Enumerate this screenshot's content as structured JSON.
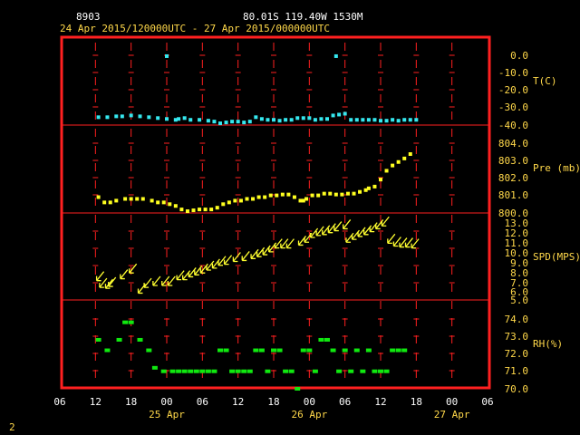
{
  "header": {
    "station_id": "8903",
    "location": "80.01S  119.40W  1530M",
    "time_range": "24 Apr 2015/120000UTC - 27 Apr 2015/000000UTC"
  },
  "footer": {
    "page_marker": "2"
  },
  "colors": {
    "background": "#000000",
    "frame": "#ff2020",
    "text_white": "#ffffff",
    "text_yellow": "#ffd84a",
    "temperature": "#35e8ef",
    "pressure": "#ffff20",
    "wind": "#ffff30",
    "rh": "#10e810"
  },
  "x_axis": {
    "hours": [
      "06",
      "12",
      "18",
      "00",
      "06",
      "12",
      "18",
      "00",
      "06",
      "12",
      "18",
      "00",
      "06"
    ],
    "dates": [
      "25 Apr",
      "26 Apr",
      "27 Apr"
    ]
  },
  "panels": {
    "temperature": {
      "label": "T(C)",
      "ticks": [
        "0.0",
        "-10.0",
        "-20.0",
        "-30.0",
        "-40.0"
      ]
    },
    "pressure": {
      "label": "Pre (mb)",
      "ticks": [
        "804.0",
        "803.0",
        "802.0",
        "801.0",
        "800.0"
      ]
    },
    "wind": {
      "label": "SPD(MPS)",
      "ticks": [
        "13.0",
        "12.0",
        "11.0",
        "10.0",
        "9.0",
        "8.0",
        "7.0",
        "6.0",
        "5.0"
      ]
    },
    "rh": {
      "label": "RH(%)",
      "ticks": [
        "74.0",
        "73.0",
        "72.0",
        "71.0",
        "70.0"
      ]
    }
  },
  "chart_data": {
    "type": "scatter",
    "title": "8903  80.01S 119.40W 1530M",
    "subtitle": "24 Apr 2015/120000UTC - 27 Apr 2015/000000UTC",
    "x_unit": "hours since 24 Apr 2015 06 UTC",
    "x_range": [
      0,
      72
    ],
    "series": [
      {
        "name": "T(C)",
        "ylim": [
          -40,
          0
        ],
        "points": [
          [
            6.5,
            -35.5
          ],
          [
            8,
            -35.5
          ],
          [
            9.5,
            -35
          ],
          [
            10.5,
            -35
          ],
          [
            12,
            -34.5
          ],
          [
            13.5,
            -35
          ],
          [
            15,
            -35.5
          ],
          [
            16.5,
            -36
          ],
          [
            18,
            -0.5
          ],
          [
            18,
            -36.5
          ],
          [
            19.5,
            -37
          ],
          [
            20,
            -36.5
          ],
          [
            21,
            -36
          ],
          [
            22,
            -37
          ],
          [
            23.5,
            -37
          ],
          [
            25,
            -37.5
          ],
          [
            26,
            -38
          ],
          [
            27,
            -39
          ],
          [
            28,
            -38.5
          ],
          [
            29,
            -38
          ],
          [
            30,
            -38
          ],
          [
            31,
            -38.5
          ],
          [
            32,
            -38
          ],
          [
            33,
            -35.5
          ],
          [
            34,
            -36.5
          ],
          [
            35,
            -37
          ],
          [
            36,
            -37
          ],
          [
            37,
            -37.5
          ],
          [
            38,
            -37
          ],
          [
            39,
            -37
          ],
          [
            40,
            -36
          ],
          [
            41,
            -36
          ],
          [
            42,
            -36
          ],
          [
            43,
            -37
          ],
          [
            44,
            -36.5
          ],
          [
            45,
            -36.5
          ],
          [
            46,
            -34.5
          ],
          [
            46.5,
            -0.5
          ],
          [
            47,
            -34
          ],
          [
            48,
            -33.5
          ],
          [
            49,
            -37
          ],
          [
            50,
            -37
          ],
          [
            51,
            -37
          ],
          [
            52,
            -37
          ],
          [
            53,
            -37
          ],
          [
            54,
            -37.5
          ],
          [
            55,
            -37.5
          ],
          [
            56,
            -37
          ],
          [
            57,
            -37.5
          ],
          [
            58,
            -37
          ],
          [
            59,
            -37
          ],
          [
            60,
            -37
          ]
        ]
      },
      {
        "name": "Pre (mb)",
        "ylim": [
          800,
          805
        ],
        "points": [
          [
            6.5,
            800.9
          ],
          [
            7.5,
            800.6
          ],
          [
            8.5,
            800.6
          ],
          [
            9.5,
            800.7
          ],
          [
            11,
            800.8
          ],
          [
            12,
            800.8
          ],
          [
            13,
            800.8
          ],
          [
            14,
            800.8
          ],
          [
            15.5,
            800.7
          ],
          [
            16.5,
            800.6
          ],
          [
            17.5,
            800.6
          ],
          [
            18.5,
            800.5
          ],
          [
            19.5,
            800.4
          ],
          [
            20.5,
            800.2
          ],
          [
            21.5,
            800.1
          ],
          [
            22.5,
            800.15
          ],
          [
            23.5,
            800.2
          ],
          [
            24.5,
            800.2
          ],
          [
            25.5,
            800.2
          ],
          [
            26.5,
            800.3
          ],
          [
            27.5,
            800.5
          ],
          [
            28.5,
            800.6
          ],
          [
            29.5,
            800.7
          ],
          [
            30.5,
            800.7
          ],
          [
            31.5,
            800.8
          ],
          [
            32.5,
            800.8
          ],
          [
            33.5,
            800.9
          ],
          [
            34.5,
            800.9
          ],
          [
            35.5,
            801
          ],
          [
            36.5,
            801
          ],
          [
            37.5,
            801.05
          ],
          [
            38.5,
            801.05
          ],
          [
            39.5,
            800.9
          ],
          [
            40.5,
            800.7
          ],
          [
            41,
            800.7
          ],
          [
            41.5,
            800.8
          ],
          [
            42.5,
            801
          ],
          [
            43.5,
            801
          ],
          [
            44.5,
            801.1
          ],
          [
            45.5,
            801.1
          ],
          [
            46.5,
            801.05
          ],
          [
            47.5,
            801.05
          ],
          [
            48.5,
            801.1
          ],
          [
            49.5,
            801.1
          ],
          [
            50.5,
            801.2
          ],
          [
            51.5,
            801.3
          ],
          [
            52,
            801.4
          ],
          [
            53,
            801.5
          ],
          [
            54,
            801.9
          ],
          [
            55,
            802.4
          ],
          [
            56,
            802.7
          ],
          [
            57,
            802.9
          ],
          [
            58,
            803.1
          ],
          [
            59,
            803.35
          ]
        ]
      },
      {
        "name": "SPD(MPS)",
        "ylim": [
          5,
          13
        ],
        "points": [
          [
            6.5,
            7.2
          ],
          [
            7,
            6.5
          ],
          [
            8,
            6.4
          ],
          [
            8.5,
            6.6
          ],
          [
            10.5,
            7.4
          ],
          [
            12,
            8
          ],
          [
            13.5,
            5.9
          ],
          [
            14.5,
            6.5
          ],
          [
            16,
            6.7
          ],
          [
            17.5,
            6.7
          ],
          [
            18.5,
            6.7
          ],
          [
            20,
            7.3
          ],
          [
            21,
            7.3
          ],
          [
            22,
            7.6
          ],
          [
            23,
            7.8
          ],
          [
            24,
            8
          ],
          [
            25,
            8.3
          ],
          [
            26,
            8.5
          ],
          [
            27,
            8.8
          ],
          [
            28,
            8.9
          ],
          [
            29.5,
            9.2
          ],
          [
            31,
            9.3
          ],
          [
            32.5,
            9.5
          ],
          [
            33.5,
            9.7
          ],
          [
            34.5,
            9.9
          ],
          [
            35.5,
            10.2
          ],
          [
            36.5,
            10.6
          ],
          [
            37.5,
            10.6
          ],
          [
            38.5,
            10.6
          ],
          [
            40.5,
            10.9
          ],
          [
            41.5,
            11.2
          ],
          [
            42.5,
            11.7
          ],
          [
            43.5,
            11.9
          ],
          [
            44.5,
            12
          ],
          [
            45.5,
            12.2
          ],
          [
            46.5,
            12.4
          ],
          [
            48,
            12.6
          ],
          [
            48.5,
            11.2
          ],
          [
            49.5,
            11.5
          ],
          [
            50.5,
            11.8
          ],
          [
            51.5,
            12
          ],
          [
            52.5,
            12.3
          ],
          [
            53.5,
            12.6
          ],
          [
            54.5,
            12.9
          ],
          [
            55.5,
            11.1
          ],
          [
            56.5,
            10.8
          ],
          [
            57.5,
            10.7
          ],
          [
            58.5,
            10.7
          ],
          [
            59.5,
            10.6
          ]
        ]
      },
      {
        "name": "RH(%)",
        "ylim": [
          70,
          74
        ],
        "points": [
          [
            6.5,
            72.8
          ],
          [
            8,
            72.2
          ],
          [
            10,
            72.8
          ],
          [
            11,
            73.8
          ],
          [
            12,
            73.8
          ],
          [
            13.5,
            72.8
          ],
          [
            15,
            72.2
          ],
          [
            16,
            71.2
          ],
          [
            17.5,
            71
          ],
          [
            19,
            71
          ],
          [
            20,
            71
          ],
          [
            21,
            71
          ],
          [
            22,
            71
          ],
          [
            23,
            71
          ],
          [
            24,
            71
          ],
          [
            25,
            71
          ],
          [
            26,
            71
          ],
          [
            27,
            72.2
          ],
          [
            28,
            72.2
          ],
          [
            29,
            71
          ],
          [
            30,
            71
          ],
          [
            31,
            71
          ],
          [
            32,
            71
          ],
          [
            33,
            72.2
          ],
          [
            34,
            72.2
          ],
          [
            35,
            71
          ],
          [
            36,
            72.2
          ],
          [
            37,
            72.2
          ],
          [
            38,
            71
          ],
          [
            39,
            71
          ],
          [
            40,
            70
          ],
          [
            41,
            72.2
          ],
          [
            42,
            72.2
          ],
          [
            43,
            71
          ],
          [
            44,
            72.8
          ],
          [
            45,
            72.8
          ],
          [
            46,
            72.2
          ],
          [
            47,
            71
          ],
          [
            48,
            72.2
          ],
          [
            49,
            71
          ],
          [
            50,
            72.2
          ],
          [
            51,
            71
          ],
          [
            52,
            72.2
          ],
          [
            53,
            71
          ],
          [
            54,
            71
          ],
          [
            55,
            71
          ],
          [
            56,
            72.2
          ],
          [
            57,
            72.2
          ],
          [
            58,
            72.2
          ]
        ]
      }
    ]
  }
}
